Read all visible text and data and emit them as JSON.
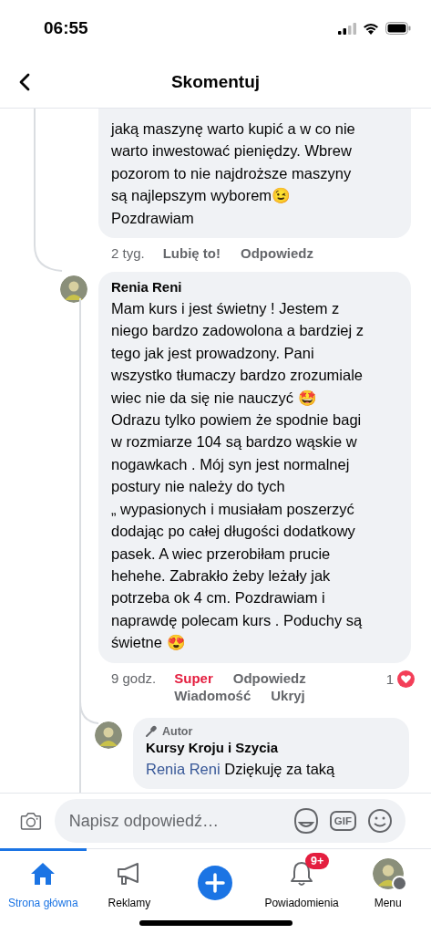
{
  "status_bar": {
    "time": "06:55"
  },
  "header": {
    "title": "Skomentuj"
  },
  "comments": [
    {
      "kind": "comment",
      "text": "jaką maszynę warto kupić a w co nie\nwarto inwestować pieniędzy. Wbrew\npozorom to nie najdroższe maszyny\nsą najlepszym wyborem😉\nPozdrawiam",
      "time": "2 tyg.",
      "actions": [
        {
          "label": "Lubię to!",
          "selected": false
        },
        {
          "label": "Odpowiedz",
          "selected": false
        }
      ]
    },
    {
      "kind": "comment",
      "author": "Renia Reni",
      "text": "Mam kurs i jest świetny ! Jestem z\nniego bardzo zadowolona a bardziej z\ntego jak jest prowadzony. Pani\nwszystko tłumaczy bardzo zrozumiale\nwiec nie da się nie nauczyć 🤩\nOdrazu tylko powiem że spodnie bagi\nw rozmiarze 104 są bardzo wąskie w\nnogawkach . Mój syn jest normalnej\npostury nie należy do tych\n„ wypasionych i musiałam poszerzyć\ndodając po całej długości dodatkowy\npasek. A wiec przerobiłam prucie\nhehehe. Zabrakło żeby leżały jak\npotrzeba ok 4 cm. Pozdrawiam i\nnaprawdę polecam kurs . Poduchy są\nświetne 😍",
      "time": "9 godz.",
      "actions": [
        {
          "label": "Super",
          "selected": true
        },
        {
          "label": "Odpowiedz",
          "selected": false
        },
        {
          "label": "Wiadomość",
          "selected": false
        },
        {
          "label": "Ukryj",
          "selected": false
        }
      ],
      "reaction_count": "1"
    },
    {
      "kind": "reply",
      "badge": "Autor",
      "author": "Kursy Kroju i Szycia",
      "mention": "Renia Reni",
      "text": "Dziękuję za taką"
    }
  ],
  "composer": {
    "placeholder": "Napisz odpowiedź…",
    "gif_label": "GIF"
  },
  "tabs": [
    {
      "kind": "home",
      "label": "Strona główna",
      "selected": true
    },
    {
      "kind": "megaphone",
      "label": "Reklamy",
      "selected": false
    },
    {
      "kind": "plus",
      "selected": false
    },
    {
      "kind": "bell",
      "label": "Powiadomienia",
      "selected": false,
      "badge": "9+"
    },
    {
      "kind": "avatar",
      "label": "Menu",
      "selected": false
    }
  ]
}
